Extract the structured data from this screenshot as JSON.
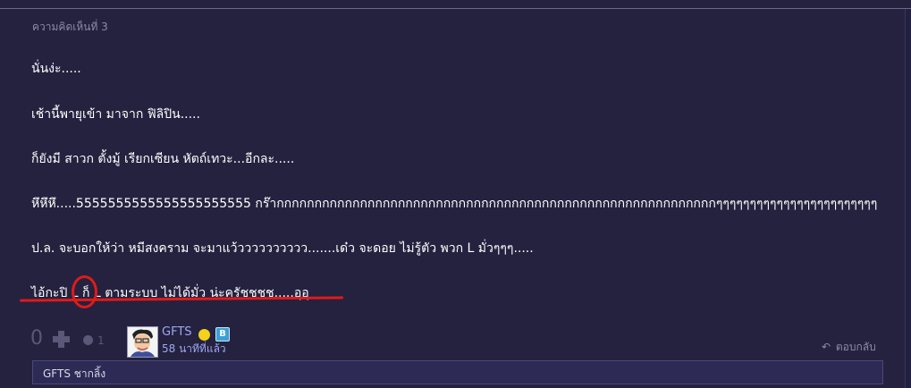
{
  "comment": {
    "number_label": "ความคิดเห็นที่ 3",
    "lines": [
      "นั่นง่ะ.....",
      "เช้านี้พายุเข้า มาจาก ฟิลิปิน.....",
      "ก็ยังมี สาวก ตั้งมู้ เรียกเซียน หัตถ์เทวะ...อีกละ.....",
      "หึหึหึ.....5555555555555555555555 กร๊ากกกกกกกกกกกกกกกกกกกกกกกกกกกกกกกกกกกกกกกกกกกกกกกกกกกกกกกกกกๆๆๆๆๆๆๆๆๆๆๆๆๆๆๆๆๆๆๆๆๆๆๆๆ",
      "ป.ล. จะบอกให้ว่า หมีสงคราม จะมาแว้วววววววววว.......เด๋ว จะดอย ไม่รู้ตัว พวก L มั่วๆๆๆ.....",
      "ไอ้กะปิ L ก็ L ตามระบบ ไม่ได้มั่ว น่ะครัชชชช.....อุอุ"
    ],
    "annotation_color": "#e01a1a"
  },
  "footer": {
    "vote_count": "0",
    "emoticon_count": "1",
    "author": "GFTS",
    "time_ago": "58 นาทีที่แล้ว",
    "badge_letter": "B",
    "reply_label": "ตอบกลับ",
    "reply_icon": "↶",
    "reply_box_text": "GFTS ชากลิ้ง"
  }
}
